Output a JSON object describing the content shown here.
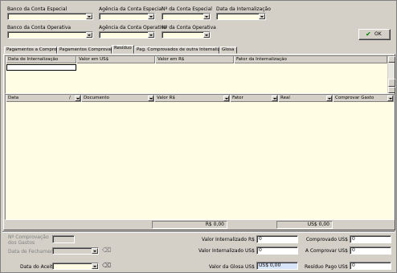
{
  "top": {
    "banco_especial_label": "Banco da Conta Especial",
    "agencia_especial_label": "Agência da Conta Especial",
    "nr_especial_label": "Nº da Conta Especial",
    "data_internalizacao_label": "Data da Internalização",
    "banco_operativa_label": "Banco da Conta Operativa",
    "agencia_operativa_label": "Agência da Conta Operativa",
    "nr_operativa_label": "Nº da Conta Operativa",
    "ok_label": "OK"
  },
  "tabs": [
    {
      "label": "Pagamentos a Comprovar"
    },
    {
      "label": "Pagamentos Comprovados"
    },
    {
      "label": "Resíduo"
    },
    {
      "label": "Pag. Comprovados de outra Internalização"
    },
    {
      "label": "Glosa"
    }
  ],
  "grid1": {
    "columns": [
      "Data de Internalização",
      "Valor em US$",
      "Valor em R$",
      "Fator da Internalização"
    ]
  },
  "grid2": {
    "columns": [
      "Data",
      "Documento",
      "Valor R$",
      "Fator",
      "Real",
      "Comprovar Gasto"
    ],
    "sort_marker": "/"
  },
  "totals": {
    "reais": "R$ 0,00",
    "dolares": "US$ 0,00"
  },
  "bottom": {
    "nr_comprovacao_label": "Nº Comprovação dos Gastos",
    "data_fechamento_label": "Data de Fechamento",
    "data_aceite_label": "Data do Aceite",
    "valor_internalizado_rs_label": "Valor Internalizado R$",
    "valor_internalizado_rs_value": "0",
    "valor_internalizado_us_label": "Valor Internalizado US$",
    "valor_internalizado_us_value": "0",
    "valor_glosa_label": "Valor da Glosa US$",
    "valor_glosa_value": "US$ 0,00",
    "comprovado_label": "Comprovado US$",
    "comprovado_value": "0",
    "a_comprovar_label": "A Comprovar US$",
    "a_comprovar_value": "0",
    "residuo_pago_label": "Resíduo Pago US$",
    "residuo_pago_value": "0"
  }
}
